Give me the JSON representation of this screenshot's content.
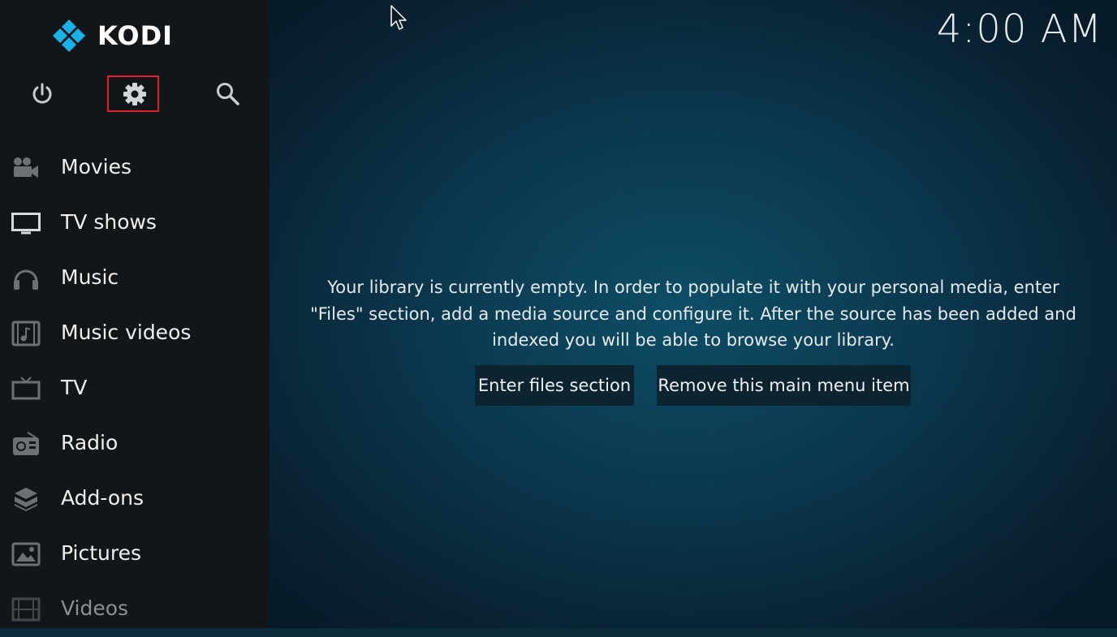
{
  "app": {
    "name": "KODI"
  },
  "clock": "4:00 AM",
  "toolbar": {
    "power_icon": "power-icon",
    "settings_icon": "gear-icon",
    "search_icon": "search-icon",
    "highlight_color": "#e0202a"
  },
  "sidebar": {
    "items": [
      {
        "label": "Movies",
        "icon": "movie-camera-icon"
      },
      {
        "label": "TV shows",
        "icon": "monitor-icon"
      },
      {
        "label": "Music",
        "icon": "headphones-icon"
      },
      {
        "label": "Music videos",
        "icon": "music-video-icon"
      },
      {
        "label": "TV",
        "icon": "tv-icon"
      },
      {
        "label": "Radio",
        "icon": "radio-icon"
      },
      {
        "label": "Add-ons",
        "icon": "addons-box-icon"
      },
      {
        "label": "Pictures",
        "icon": "pictures-icon"
      },
      {
        "label": "Videos",
        "icon": "film-strip-icon"
      }
    ]
  },
  "main": {
    "message_line1": "Your library is currently empty. In order to populate it with your personal media, enter",
    "message_line2": "\"Files\" section, add a media source and configure it. After the source has been added and",
    "message_line3": "indexed you will be able to browse your library.",
    "enter_files_button": "Enter files section",
    "remove_item_button": "Remove this main menu item"
  },
  "colors": {
    "sidebar_bg": "#131618",
    "main_bg": "#0b3a50",
    "button_bg": "#0c2430",
    "logo_blue": "#17b2e7"
  }
}
